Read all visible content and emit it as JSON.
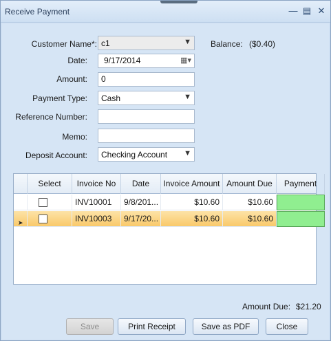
{
  "window": {
    "title": "Receive Payment"
  },
  "form": {
    "customer_label": "Customer Name*:",
    "customer_value": "c1",
    "balance_label": "Balance:",
    "balance_value": "($0.40)",
    "date_label": "Date:",
    "date_value": "9/17/2014",
    "amount_label": "Amount:",
    "amount_value": "0",
    "payment_type_label": "Payment Type:",
    "payment_type_value": "Cash",
    "reference_label": "Reference Number:",
    "reference_value": "",
    "memo_label": "Memo:",
    "memo_value": "",
    "deposit_label": "Deposit Account:",
    "deposit_value": "Checking Account"
  },
  "grid": {
    "columns": [
      "Select",
      "Invoice No",
      "Date",
      "Invoice Amount",
      "Amount Due",
      "Payment"
    ],
    "rows": [
      {
        "invoice_no": "INV10001",
        "date": "9/8/201...",
        "invoice_amount": "$10.60",
        "amount_due": "$10.60",
        "payment": ""
      },
      {
        "invoice_no": "INV10003",
        "date": "9/17/20...",
        "invoice_amount": "$10.60",
        "amount_due": "$10.60",
        "payment": ""
      }
    ]
  },
  "footer": {
    "amount_due_label": "Amount Due:",
    "amount_due_value": "$21.20"
  },
  "buttons": {
    "save": "Save",
    "print_receipt": "Print Receipt",
    "save_pdf": "Save as PDF",
    "close": "Close"
  },
  "icons": {
    "minimize": "minimize-icon",
    "maximize": "maximize-icon",
    "close": "close-icon",
    "calendar": "calendar-icon",
    "dropdown": "chevron-down-icon",
    "row_indicator": "row-pointer-icon"
  },
  "colors": {
    "selected_row": "#f9c96a",
    "payment_cell": "#90ee90",
    "window_bg": "#d6e5f5"
  }
}
